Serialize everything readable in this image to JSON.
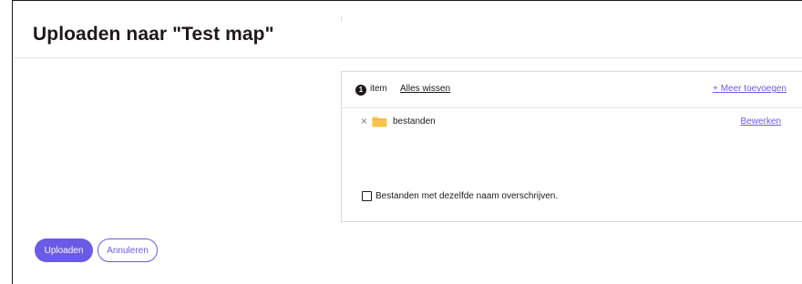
{
  "dialog": {
    "title": "Uploaden naar \"Test map\""
  },
  "panel": {
    "item_count": "1",
    "item_count_label": "item",
    "clear_all_label": "Alles wissen",
    "add_more_label": "+ Meer toevoegen",
    "items": [
      {
        "remove_glyph": "×",
        "icon": "folder-icon",
        "name": "bestanden",
        "edit_label": "Bewerken"
      }
    ],
    "overwrite_checkbox": {
      "label": "Bestanden met dezelfde naam overschrijven.",
      "checked": false
    }
  },
  "footer": {
    "upload_label": "Uploaden",
    "cancel_label": "Annuleren"
  },
  "colors": {
    "accent": "#6a5be6",
    "folder": "#f7c54e",
    "text": "#1e1919"
  }
}
